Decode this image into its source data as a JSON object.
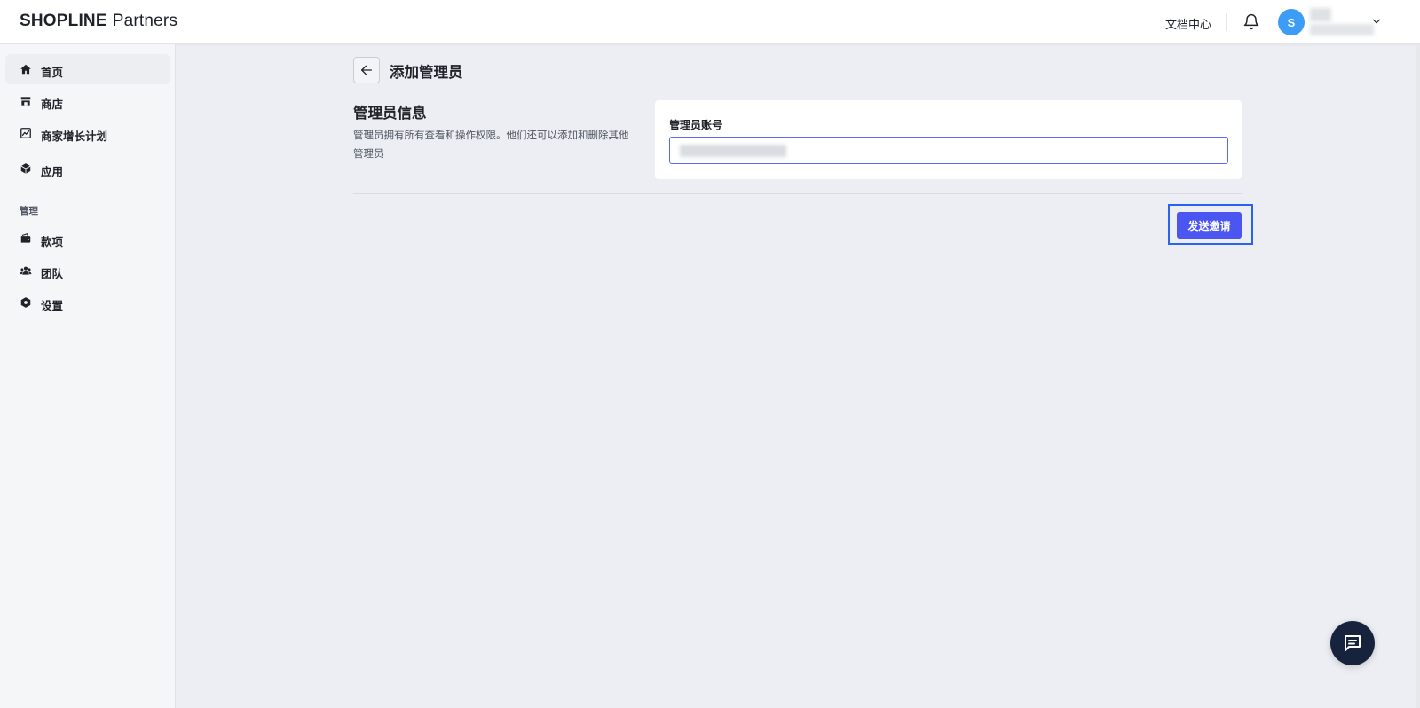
{
  "header": {
    "logo_brand": "SHOPLINE",
    "logo_suffix": "Partners",
    "doc_center": "文档中心",
    "avatar_initial": "S"
  },
  "sidebar": {
    "items": [
      {
        "label": "首页",
        "icon": "home-icon",
        "active": true
      },
      {
        "label": "商店",
        "icon": "store-icon",
        "active": false
      },
      {
        "label": "商家增长计划",
        "icon": "growth-chart-icon",
        "active": false
      },
      {
        "label": "应用",
        "icon": "app-cube-icon",
        "active": false
      }
    ],
    "section_title": "管理",
    "manage_items": [
      {
        "label": "款项",
        "icon": "wallet-icon"
      },
      {
        "label": "团队",
        "icon": "team-icon"
      },
      {
        "label": "设置",
        "icon": "settings-icon"
      }
    ]
  },
  "main": {
    "page_title": "添加管理员",
    "section_title": "管理员信息",
    "section_desc": "管理员拥有所有查看和操作权限。他们还可以添加和删除其他管理员",
    "field_label": "管理员账号",
    "send_button": "发送邀请"
  },
  "colors": {
    "accent": "#4b55f0",
    "focus_ring": "#2864f0",
    "avatar": "#3c9cf6",
    "chat_fab": "#17233d"
  }
}
